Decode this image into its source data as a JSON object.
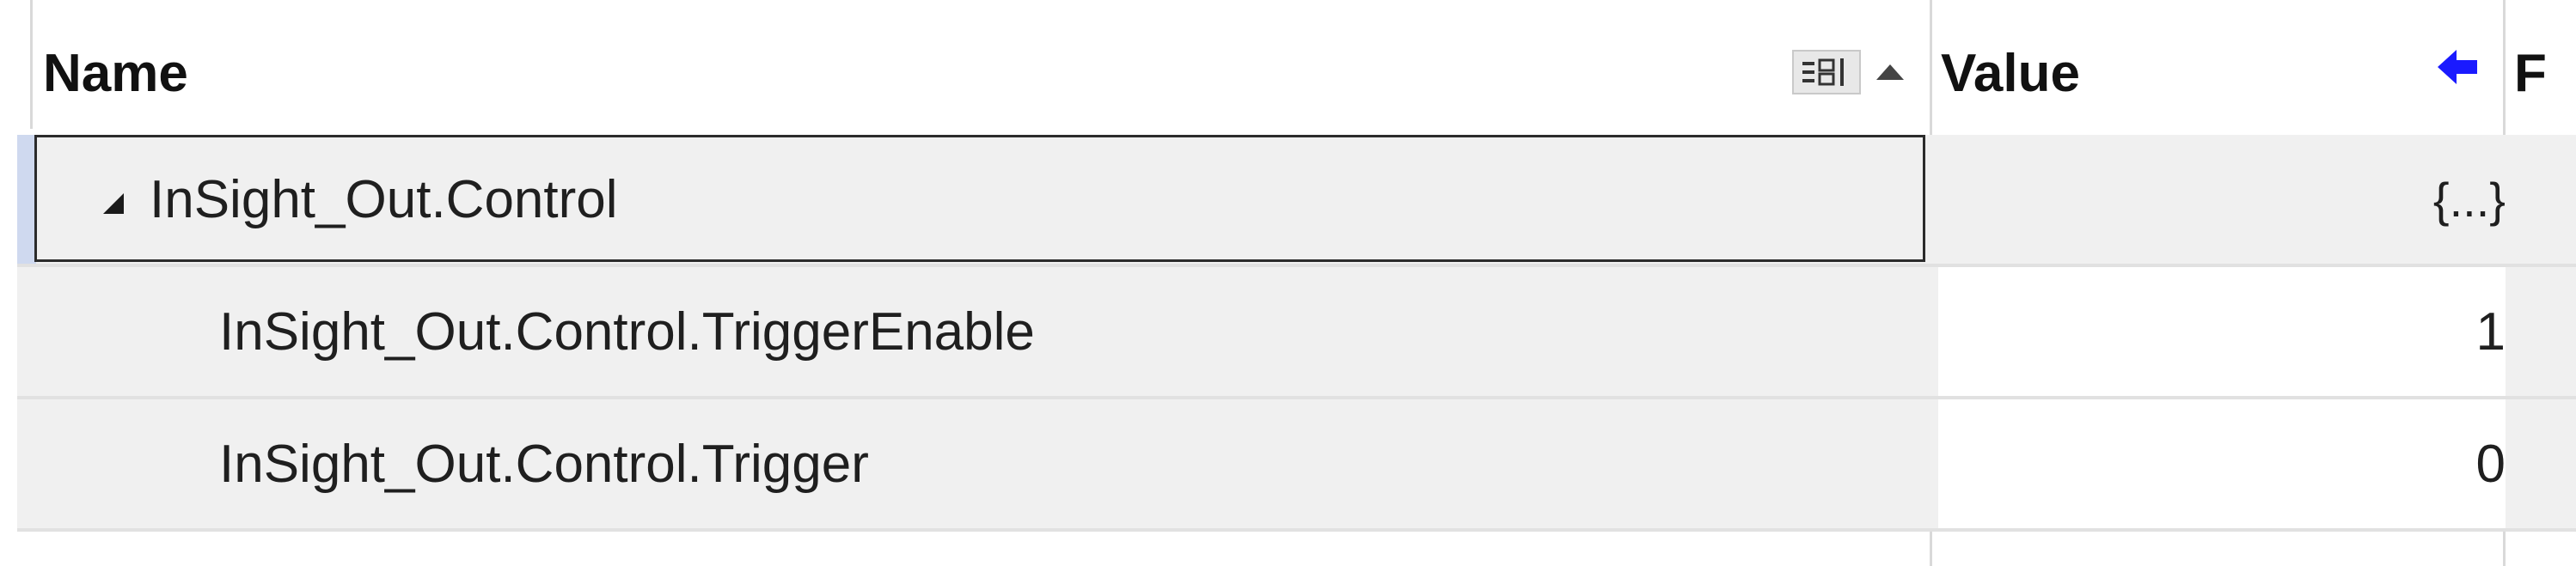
{
  "header": {
    "name_label": "Name",
    "value_label": "Value",
    "format_label": "F",
    "tools": {
      "column_chooser_icon": "column-chooser-icon",
      "sort_icon": "sort-ascending-icon",
      "pin_icon": "arrow-left-icon"
    }
  },
  "rows": [
    {
      "name": "InSight_Out.Control",
      "value": "{...}",
      "expanded": true,
      "selected": true
    },
    {
      "name": "InSight_Out.Control.TriggerEnable",
      "value": "1"
    },
    {
      "name": "InSight_Out.Control.Trigger",
      "value": "0"
    }
  ],
  "colors": {
    "pin_icon": "#1a1aff",
    "selection_accent": "#cfd9ef",
    "row_background": "#f0f0f0",
    "value_background": "#ffffff"
  }
}
